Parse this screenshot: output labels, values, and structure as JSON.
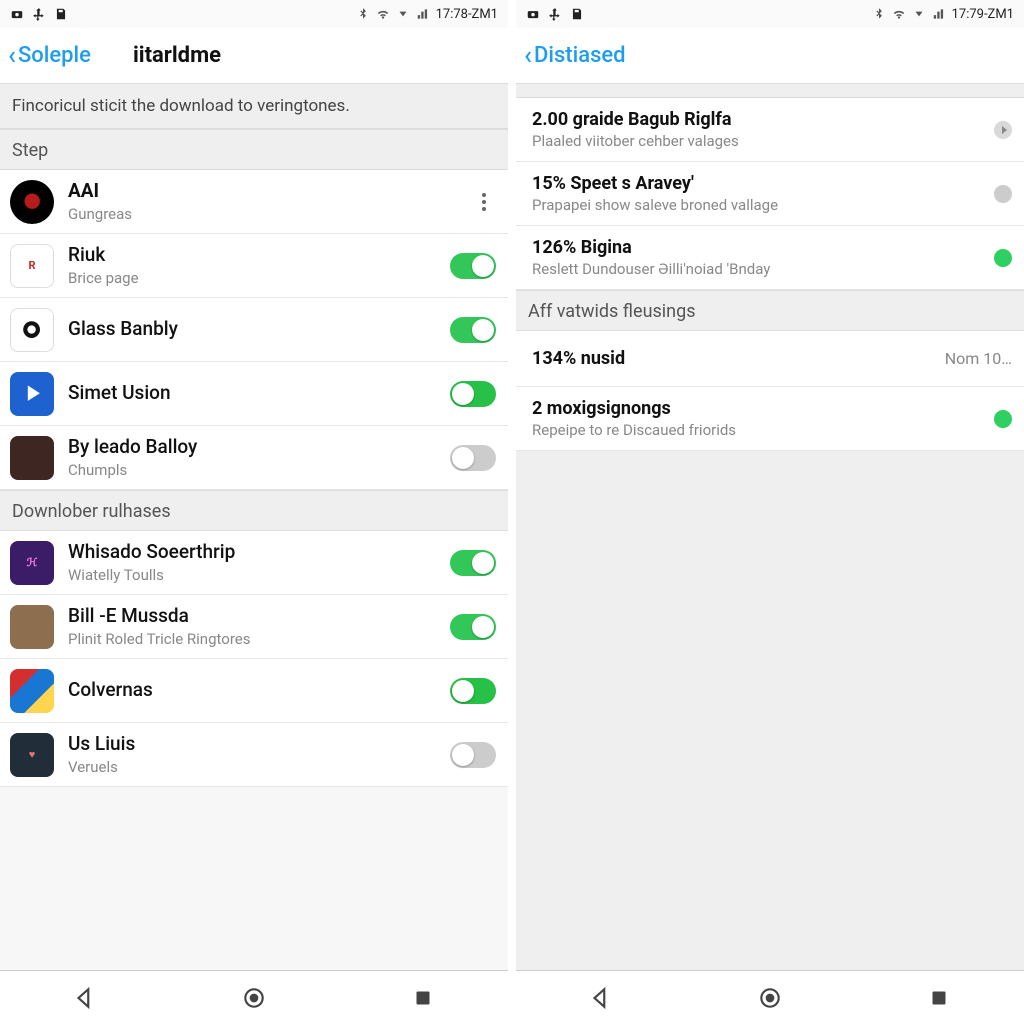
{
  "statusbar": {
    "time_left": "17:78-ZM1",
    "time_right": "17:79-ZM1"
  },
  "left": {
    "back_label": "Soleple",
    "title": "iitarldme",
    "description": "Fincoricul sticit the download to veringtones.",
    "section1": "Step",
    "section2": "Downlober rulhases",
    "apps1": [
      {
        "title": "AAI",
        "sub": "Gungreas",
        "control": "kebab"
      },
      {
        "title": "Riuk",
        "sub": "Brice page",
        "control": "toggle",
        "on": true
      },
      {
        "title": "Glass Banbly",
        "sub": "",
        "control": "toggle",
        "on": true
      },
      {
        "title": "Simet Usion",
        "sub": "",
        "control": "toggle_var2",
        "on": true
      },
      {
        "title": "By leado Balloy",
        "sub": "Chumpls",
        "control": "toggle",
        "on": false
      }
    ],
    "apps2": [
      {
        "title": "Whisado Soeerthrip",
        "sub": "Wiatelly Toulls",
        "control": "toggle",
        "on": true
      },
      {
        "title": "Bill -E Mussda",
        "sub": "Plinit Roled Tricle Ringtores",
        "control": "toggle",
        "on": true
      },
      {
        "title": "Colvernas",
        "sub": "",
        "control": "toggle_var2",
        "on": true
      },
      {
        "title": "Us Liuis",
        "sub": "Veruels",
        "control": "toggle",
        "on": false
      }
    ]
  },
  "right": {
    "back_label": "Distiased",
    "items1": [
      {
        "title": "2.00 graide Bagub Riglfa",
        "sub": "Plaaled viitober cehber valages",
        "end": "arrow"
      },
      {
        "title": "15% Speet s Aravey'",
        "sub": "Prapapei show saleve broned vallage",
        "end": "grey"
      },
      {
        "title": "126% Bigina",
        "sub": "Reslett Dundouser Əilli'noiad 'Bnday",
        "end": "green"
      }
    ],
    "section": "Aff vatwids fleusings",
    "items2": [
      {
        "title": "134% nusid",
        "sub": "",
        "end_text": "Nom 10…"
      },
      {
        "title": "2 moxigsignongs",
        "sub": "Repeipe to re Discaued friorids",
        "end": "green"
      }
    ]
  }
}
